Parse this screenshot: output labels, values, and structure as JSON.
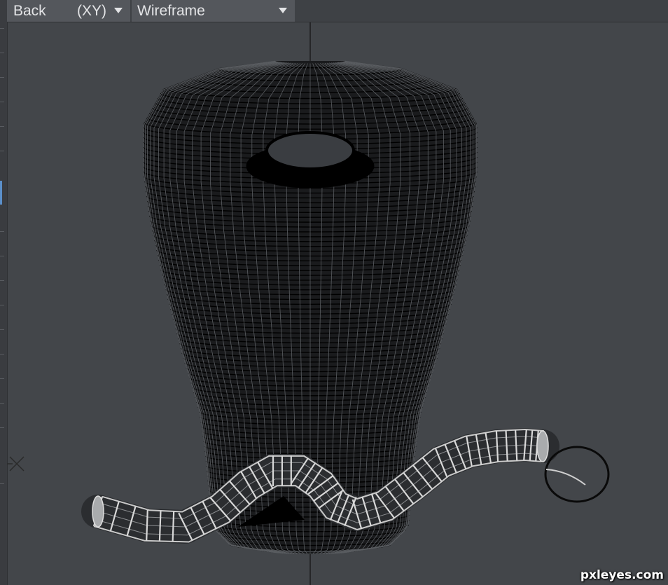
{
  "viewport_header": {
    "view_label": "Back",
    "projection_label": "(XY)",
    "shading_mode_label": "Wireframe"
  },
  "watermark": "pxleyes.com",
  "colors": {
    "viewport_background": "#43464a",
    "header_button": "#54575c",
    "wireframe_mesh": "#000000",
    "selected_tube": "#c8c8c8",
    "axis_line": "#1a1a1a"
  },
  "icons": [
    "dropdown-arrow-icon",
    "origin-axis-icon",
    "selection-circle-icon"
  ]
}
